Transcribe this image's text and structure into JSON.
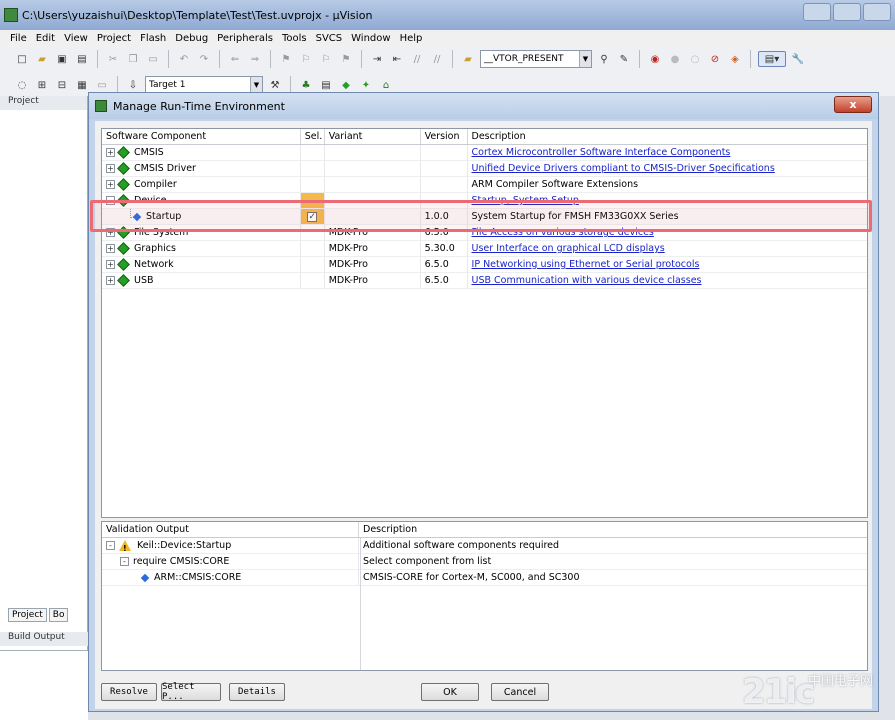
{
  "window": {
    "title": "C:\\Users\\yuzaishui\\Desktop\\Template\\Test\\Test.uvprojx - µVision"
  },
  "menu": [
    "File",
    "Edit",
    "View",
    "Project",
    "Flash",
    "Debug",
    "Peripherals",
    "Tools",
    "SVCS",
    "Window",
    "Help"
  ],
  "toolbar": {
    "define_combo": "__VTOR_PRESENT",
    "target_combo": "Target 1"
  },
  "left_panel": {
    "header": "Project",
    "tab_project": "Project",
    "tab_books": "Bo",
    "build_output": "Build Output"
  },
  "dialog": {
    "title": "Manage Run-Time Environment",
    "close_label": "x",
    "columns": {
      "component": "Software Component",
      "sel": "Sel.",
      "variant": "Variant",
      "version": "Version",
      "description": "Description"
    },
    "rows": [
      {
        "name": "CMSIS",
        "variant": "",
        "version": "",
        "description": "Cortex Microcontroller Software Interface Components",
        "link": true,
        "expander": "+"
      },
      {
        "name": "CMSIS Driver",
        "variant": "",
        "version": "",
        "description": "Unified Device Drivers compliant to CMSIS-Driver Specifications",
        "link": true,
        "expander": "+"
      },
      {
        "name": "Compiler",
        "variant": "",
        "version": "",
        "description": "ARM Compiler Software Extensions",
        "link": false,
        "expander": "+"
      },
      {
        "name": "Device",
        "variant": "",
        "version": "",
        "description": "Startup, System Setup",
        "link": true,
        "expander": "-"
      },
      {
        "name": "Startup",
        "variant": "",
        "version": "1.0.0",
        "description": "System Startup for FMSH FM33G0XX Series",
        "link": false,
        "child": true,
        "checked": true
      },
      {
        "name": "File System",
        "variant": "MDK-Pro",
        "version": "6.5.0",
        "description": "File Access on various storage devices",
        "link": true,
        "expander": "+"
      },
      {
        "name": "Graphics",
        "variant": "MDK-Pro",
        "version": "5.30.0",
        "description": "User Interface on graphical LCD displays",
        "link": true,
        "expander": "+"
      },
      {
        "name": "Network",
        "variant": "MDK-Pro",
        "version": "6.5.0",
        "description": "IP Networking using Ethernet or Serial protocols",
        "link": true,
        "expander": "+"
      },
      {
        "name": "USB",
        "variant": "MDK-Pro",
        "version": "6.5.0",
        "description": "USB Communication with various device classes",
        "link": true,
        "expander": "+"
      }
    ],
    "validation": {
      "col_output": "Validation Output",
      "col_description": "Description",
      "rows": [
        {
          "output": "Keil::Device:Startup",
          "description": "Additional software components required",
          "level": 0
        },
        {
          "output": "require CMSIS:CORE",
          "description": "Select component from list",
          "level": 1
        },
        {
          "output": "ARM::CMSIS:CORE",
          "description": "CMSIS-CORE for Cortex-M, SC000, and SC300",
          "level": 2
        }
      ]
    },
    "buttons": {
      "resolve": "Resolve",
      "select_packs": "Select P...",
      "details": "Details",
      "ok": "OK",
      "cancel": "Cancel"
    }
  },
  "watermark": {
    "logo": "21ic",
    "text": "中国电子网"
  },
  "colors": {
    "link": "#1a23c8",
    "selected_cell": "#f3b94a",
    "highlight": "#ec6a73",
    "component_icon": "#22a022"
  }
}
